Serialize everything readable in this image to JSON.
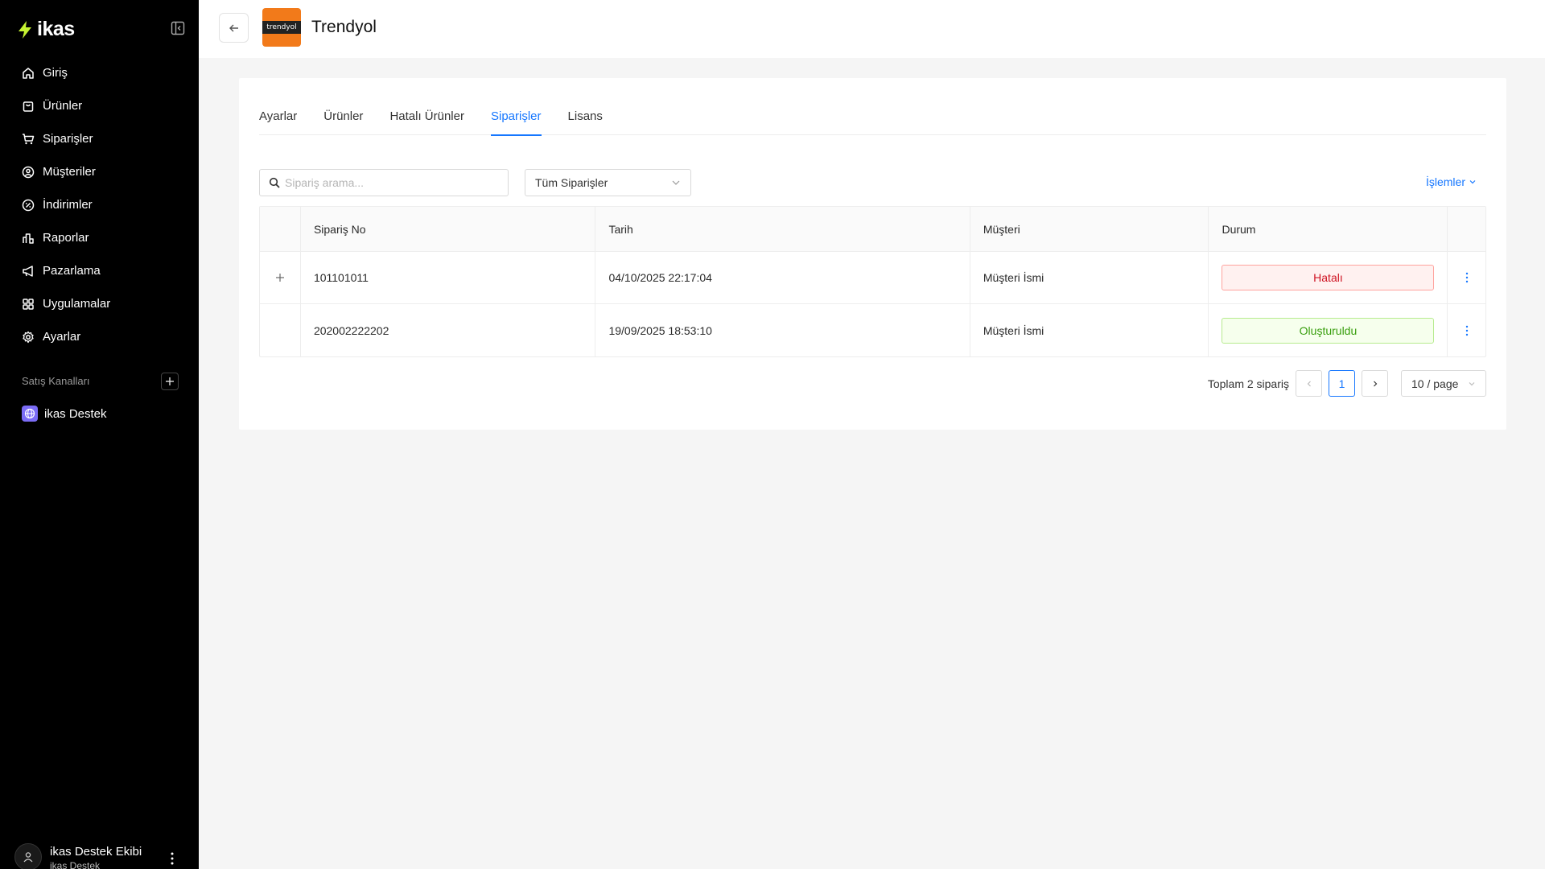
{
  "sidebar": {
    "logo": "ikas",
    "items": [
      {
        "label": "Giriş",
        "icon": "home-icon"
      },
      {
        "label": "Ürünler",
        "icon": "bag-icon"
      },
      {
        "label": "Siparişler",
        "icon": "cart-icon"
      },
      {
        "label": "Müşteriler",
        "icon": "user-circle-icon"
      },
      {
        "label": "İndirimler",
        "icon": "discount-icon"
      },
      {
        "label": "Raporlar",
        "icon": "chart-icon"
      },
      {
        "label": "Pazarlama",
        "icon": "megaphone-icon"
      },
      {
        "label": "Uygulamalar",
        "icon": "apps-icon"
      },
      {
        "label": "Ayarlar",
        "icon": "gear-icon"
      }
    ],
    "section_label": "Satış Kanalları",
    "channel": "ikas Destek",
    "user": {
      "name": "ikas Destek Ekibi",
      "subtitle": "ikas Destek"
    }
  },
  "header": {
    "title": "Trendyol",
    "brand_logo_text": "trendyol"
  },
  "tabs": [
    {
      "label": "Ayarlar",
      "active": false
    },
    {
      "label": "Ürünler",
      "active": false
    },
    {
      "label": "Hatalı Ürünler",
      "active": false
    },
    {
      "label": "Siparişler",
      "active": true
    },
    {
      "label": "Lisans",
      "active": false
    }
  ],
  "search": {
    "placeholder": "Sipariş arama..."
  },
  "filter": {
    "selected": "Tüm Siparişler"
  },
  "actions_label": "İşlemler",
  "table": {
    "columns": [
      "Sipariş No",
      "Tarih",
      "Müşteri",
      "Durum"
    ],
    "rows": [
      {
        "order_no": "101101011",
        "date": "04/10/2025 22:17:04",
        "customer": "Müşteri İsmi",
        "status": "Hatalı",
        "expandable": true
      },
      {
        "order_no": "202002222202",
        "date": "19/09/2025 18:53:10",
        "customer": "Müşteri İsmi",
        "status": "Oluşturuldu",
        "expandable": false
      }
    ]
  },
  "pagination": {
    "total": "Toplam 2 sipariş",
    "current_page": "1",
    "page_size": "10 / page"
  },
  "colors": {
    "accent": "#1677ff",
    "error": "#cf1322",
    "success": "#389e0d",
    "brand": "#f27a1a",
    "sidebar_bg": "#000000",
    "logo_bolt": "#c6f432"
  }
}
